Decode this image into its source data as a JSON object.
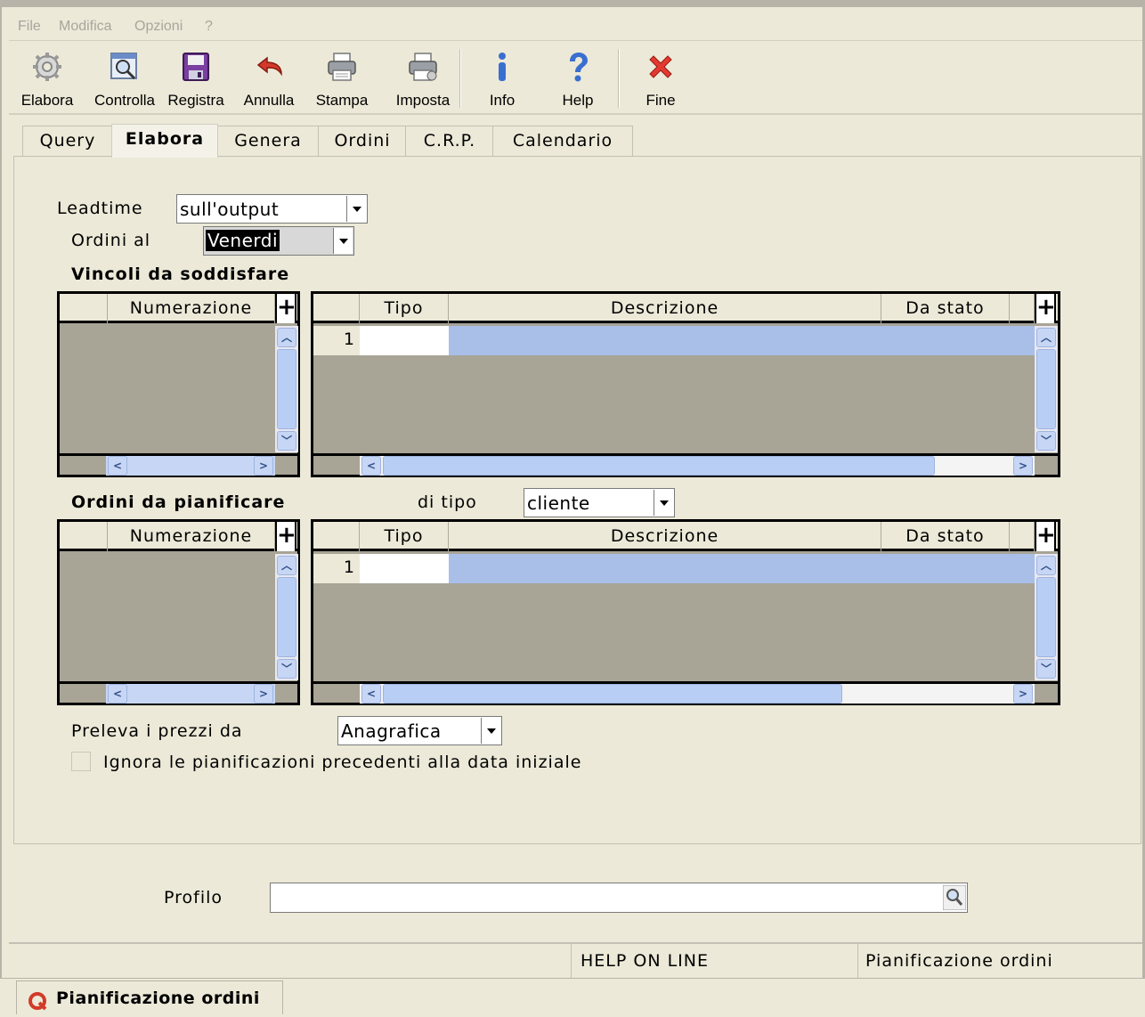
{
  "menu": [
    "File",
    "Modifica",
    "Opzioni",
    "?"
  ],
  "toolbar": {
    "elabora": "Elabora",
    "controlla": "Controlla",
    "registra": "Registra",
    "annulla": "Annulla",
    "stampa": "Stampa",
    "imposta": "Imposta",
    "info": "Info",
    "help": "Help",
    "fine": "Fine"
  },
  "tabs": [
    "Query",
    "Elabora",
    "Genera",
    "Ordini",
    "C.R.P.",
    "Calendario"
  ],
  "form": {
    "leadtime_label": "Leadtime",
    "leadtime_value": "sull'output",
    "ordini_al_label": "Ordini al",
    "ordini_al_value": "Venerdi",
    "vincoli_title": "Vincoli da soddisfare",
    "ordini_title": "Ordini da pianificare",
    "di_tipo_label": "di tipo",
    "di_tipo_value": "cliente",
    "preleva_label": "Preleva i prezzi da",
    "preleva_value": "Anagrafica",
    "ignora_label": "Ignora le pianificazioni precedenti alla data iniziale"
  },
  "grid_left": {
    "col": "Numerazione",
    "plus": "+"
  },
  "grid_right": {
    "cols": [
      "Tipo",
      "Descrizione",
      "Da stato"
    ],
    "plus": "+",
    "row_number": "1"
  },
  "profilo": {
    "label": "Profilo",
    "value": ""
  },
  "status": {
    "help": "HELP ON LINE",
    "title": "Pianificazione ordini"
  },
  "taskbar": {
    "label": "Pianificazione ordini"
  },
  "colors": {
    "selected_row": "#a9bfe8",
    "grid_bg": "#a8a496",
    "scroll": "#c6d6f4"
  }
}
